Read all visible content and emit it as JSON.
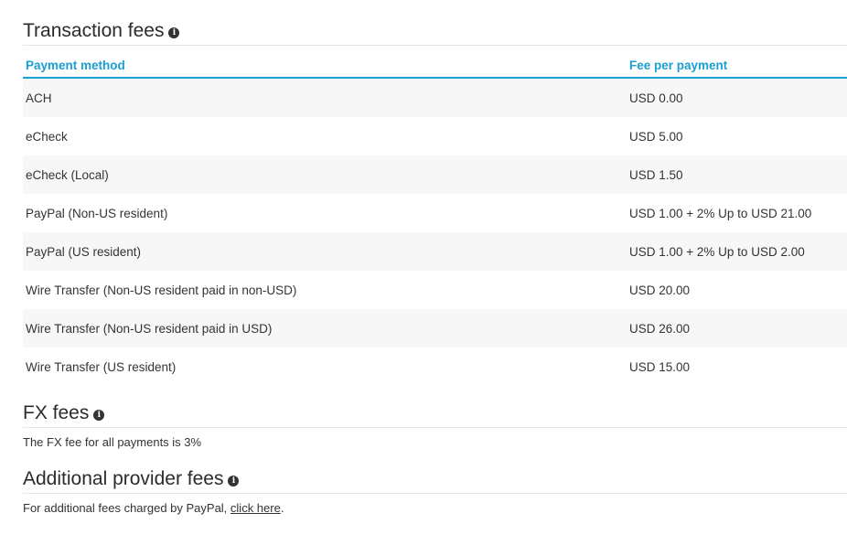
{
  "transaction_fees": {
    "title": "Transaction fees",
    "columns": {
      "method": "Payment method",
      "fee": "Fee per payment"
    },
    "rows": [
      {
        "method": "ACH",
        "fee": "USD 0.00"
      },
      {
        "method": "eCheck",
        "fee": "USD 5.00"
      },
      {
        "method": "eCheck (Local)",
        "fee": "USD 1.50"
      },
      {
        "method": "PayPal (Non-US resident)",
        "fee": "USD 1.00 + 2% Up to USD 21.00"
      },
      {
        "method": "PayPal (US resident)",
        "fee": "USD 1.00 + 2% Up to USD 2.00"
      },
      {
        "method": "Wire Transfer (Non-US resident paid in non-USD)",
        "fee": "USD 20.00"
      },
      {
        "method": "Wire Transfer (Non-US resident paid in USD)",
        "fee": "USD 26.00"
      },
      {
        "method": "Wire Transfer (US resident)",
        "fee": "USD 15.00"
      }
    ]
  },
  "fx_fees": {
    "title": "FX fees",
    "text": "The FX fee for all payments is 3%"
  },
  "additional_fees": {
    "title": "Additional provider fees",
    "text_before": "For additional fees charged by PayPal, ",
    "link_label": "click here",
    "text_after": "."
  },
  "icons": {
    "info": "info-icon"
  },
  "colors": {
    "accent": "#1a9fd3",
    "row_alt": "#f7f7f7"
  }
}
